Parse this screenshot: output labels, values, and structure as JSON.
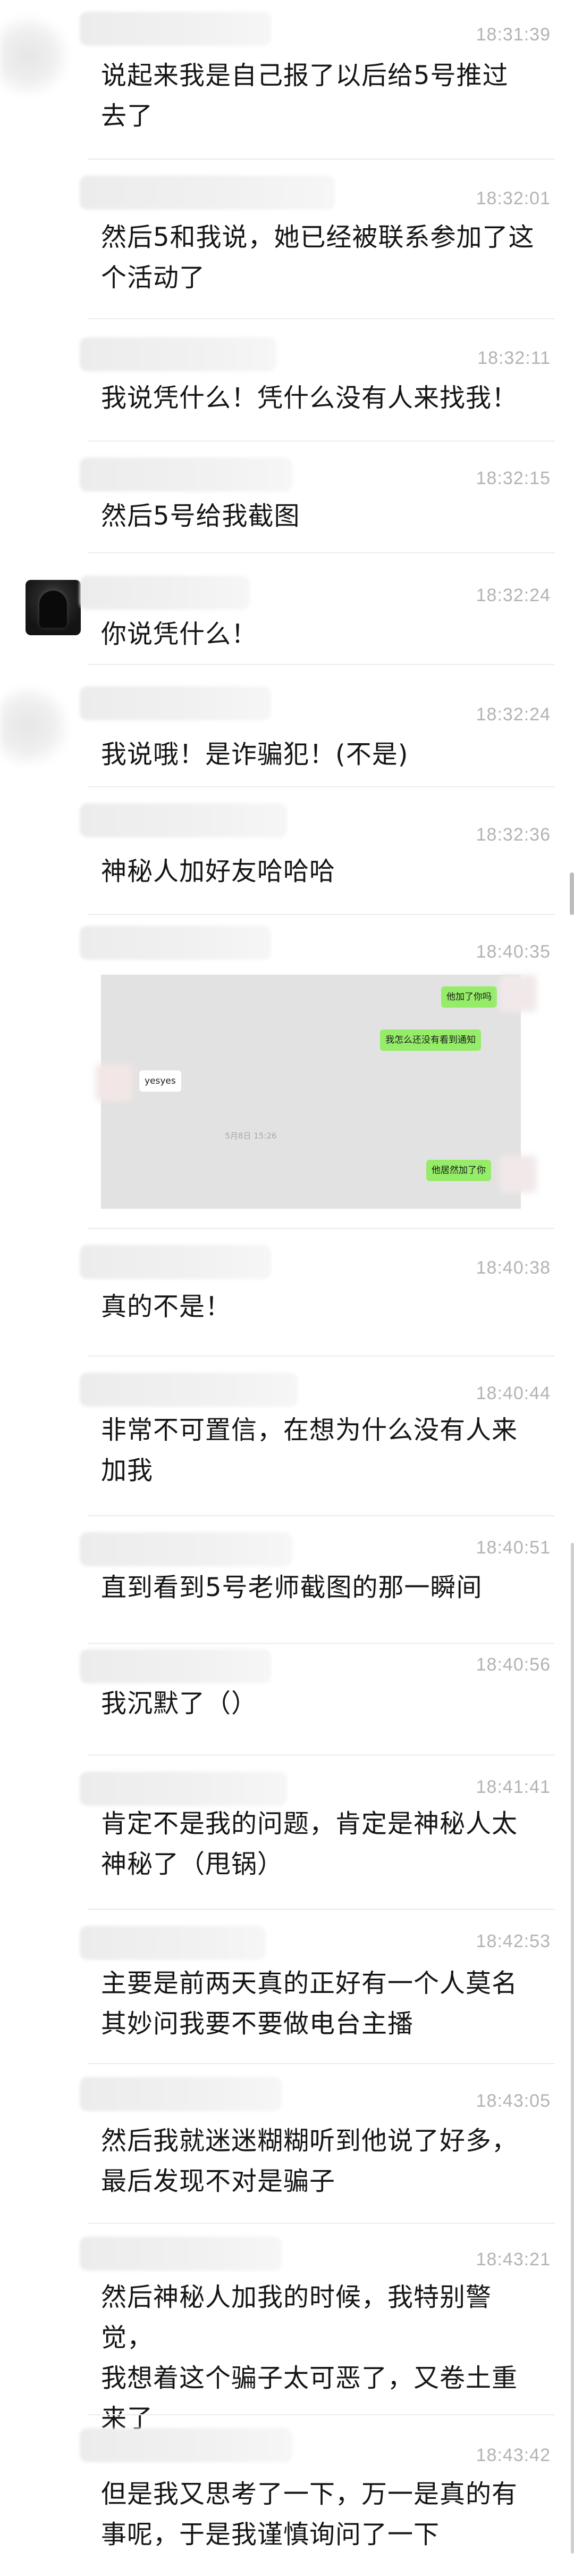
{
  "messages": [
    {
      "time": "18:31:39",
      "lines": [
        "说起来我是自己报了以后给5号推过",
        "去了"
      ]
    },
    {
      "time": "18:32:01",
      "lines": [
        "然后5和我说，她已经被联系参加了这",
        "个活动了"
      ]
    },
    {
      "time": "18:32:11",
      "lines": [
        "我说凭什么！凭什么没有人来找我！"
      ]
    },
    {
      "time": "18:32:15",
      "lines": [
        "然后5号给我截图"
      ]
    },
    {
      "time": "18:32:24",
      "lines": [
        "你说凭什么！"
      ]
    },
    {
      "time": "18:32:24",
      "lines": [
        "我说哦！是诈骗犯！(不是)"
      ]
    },
    {
      "time": "18:32:36",
      "lines": [
        "神秘人加好友哈哈哈"
      ]
    },
    {
      "time": "18:40:35",
      "screenshot": {
        "bubbles": [
          "他加了你吗",
          "我怎么还没有看到通知",
          "yesyes",
          "他居然加了你"
        ],
        "date": "5月8日 15:26"
      }
    },
    {
      "time": "18:40:38",
      "lines": [
        "真的不是！"
      ]
    },
    {
      "time": "18:40:44",
      "lines": [
        "非常不可置信，在想为什么没有人来",
        "加我"
      ]
    },
    {
      "time": "18:40:51",
      "lines": [
        "直到看到5号老师截图的那一瞬间"
      ]
    },
    {
      "time": "18:40:56",
      "lines": [
        "我沉默了（）"
      ]
    },
    {
      "time": "18:41:41",
      "lines": [
        "肯定不是我的问题，肯定是神秘人太",
        "神秘了（甩锅）"
      ]
    },
    {
      "time": "18:42:53",
      "lines": [
        "主要是前两天真的正好有一个人莫名",
        "其妙问我要不要做电台主播"
      ]
    },
    {
      "time": "18:43:05",
      "lines": [
        "然后我就迷迷糊糊听到他说了好多，",
        "最后发现不对是骗子"
      ]
    },
    {
      "time": "18:43:21",
      "lines": [
        "然后神秘人加我的时候，我特别警觉，",
        "我想着这个骗子太可恶了，又卷土重",
        "来了"
      ]
    },
    {
      "time": "18:43:42",
      "lines": [
        "但是我又思考了一下，万一是真的有",
        "事呢，于是我谨慎询问了一下"
      ]
    }
  ]
}
